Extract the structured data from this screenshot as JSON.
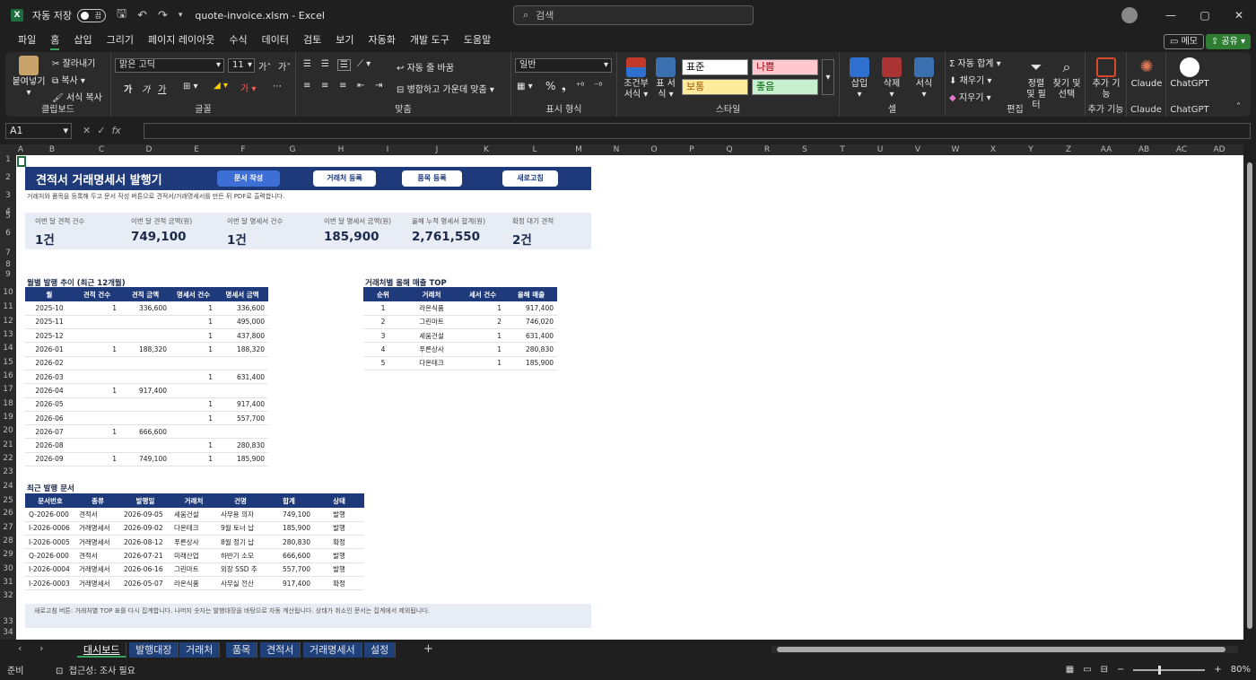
{
  "window": {
    "autosave_label": "자동 저장",
    "autosave_state": "끔",
    "filename": "quote-invoice.xlsm",
    "app": "Excel",
    "search_placeholder": "검색"
  },
  "menu": [
    "파일",
    "홈",
    "삽입",
    "그리기",
    "페이지 레이아웃",
    "수식",
    "데이터",
    "검토",
    "보기",
    "자동화",
    "개발 도구",
    "도움말"
  ],
  "menu_active": "홈",
  "memo_label": "메모",
  "share_label": "공유",
  "ribbon": {
    "paste": "붙여넣기",
    "cut": "잘라내기",
    "copy": "복사",
    "format_painter": "서식 복사",
    "clipboard": "클립보드",
    "font_name": "맑은 고딕",
    "font_size": "11",
    "font_group": "글꼴",
    "wrap_text": "자동 줄 바꿈",
    "merge_center": "병합하고 가운데 맞춤",
    "align_group": "맞춤",
    "number_format": "일반",
    "number_group": "표시 형식",
    "cond_format": "조건부 서식",
    "table_format": "표 서식",
    "style_normal": "표준",
    "style_bad": "나쁨",
    "style_neutral": "보통",
    "style_good": "좋음",
    "style_group": "스타일",
    "insert": "삽입",
    "delete": "삭제",
    "format": "서식",
    "cells_group": "셀",
    "autosum": "자동 합계",
    "fill": "채우기",
    "clear": "지우기",
    "sort_filter": "정렬 및 필터",
    "find_select": "찾기 및 선택",
    "edit_group": "편집",
    "addins": "추가 기능",
    "addins_group": "추가 기능",
    "claude": "Claude",
    "chatgpt": "ChatGPT",
    "fontbtn_b": "가",
    "fontbtn_i": "가",
    "fontbtn_u": "가"
  },
  "formula": {
    "name_box": "A1",
    "fx": "fx",
    "value": ""
  },
  "columns": [
    "A",
    "B",
    "C",
    "D",
    "E",
    "F",
    "G",
    "H",
    "I",
    "J",
    "K",
    "L",
    "M",
    "N",
    "O",
    "P",
    "Q",
    "R",
    "S",
    "T",
    "U",
    "V",
    "W",
    "X",
    "Y",
    "Z",
    "AA",
    "AB",
    "AC",
    "AD"
  ],
  "rows": [
    "1",
    "2",
    "3",
    "4",
    "5",
    "6",
    "7",
    "8",
    "9",
    "10",
    "11",
    "12",
    "13",
    "14",
    "15",
    "16",
    "17",
    "18",
    "19",
    "20",
    "21",
    "22",
    "23",
    "24",
    "25",
    "26",
    "27",
    "28",
    "29",
    "30",
    "31",
    "32",
    "33",
    "34"
  ],
  "dashboard": {
    "title": "견적서 거래명세서 발행기",
    "buttons": [
      "문서 작성",
      "거래처 등록",
      "품목 등록",
      "새로고침"
    ],
    "subtitle": "거래처와 품목을 등록해 두고 문서 작성 버튼으로 견적서/거래명세서를 만든 뒤 PDF로 출력합니다.",
    "kpis": [
      {
        "label": "이번 달 견적 건수",
        "value": "1건"
      },
      {
        "label": "이번 달 견적 금액(원)",
        "value": "749,100"
      },
      {
        "label": "이번 달 명세서 건수",
        "value": "1건"
      },
      {
        "label": "이번 달 명세서 금액(원)",
        "value": "185,900"
      },
      {
        "label": "올해 누적 명세서 합계(원)",
        "value": "2,761,550"
      },
      {
        "label": "확정 대기 견적",
        "value": "2건"
      }
    ],
    "monthly_title": "월별 발행 추이 (최근 12개월)",
    "monthly_headers": [
      "월",
      "견적 건수",
      "견적 금액",
      "명세서 건수",
      "명세서 금액"
    ],
    "monthly_rows": [
      [
        "2025-10",
        "1",
        "336,600",
        "1",
        "336,600"
      ],
      [
        "2025-11",
        "",
        "",
        "1",
        "495,000"
      ],
      [
        "2025-12",
        "",
        "",
        "1",
        "437,800"
      ],
      [
        "2026-01",
        "1",
        "188,320",
        "1",
        "188,320"
      ],
      [
        "2026-02",
        "",
        "",
        "",
        ""
      ],
      [
        "2026-03",
        "",
        "",
        "1",
        "631,400"
      ],
      [
        "2026-04",
        "1",
        "917,400",
        "",
        ""
      ],
      [
        "2026-05",
        "",
        "",
        "1",
        "917,400"
      ],
      [
        "2026-06",
        "",
        "",
        "1",
        "557,700"
      ],
      [
        "2026-07",
        "1",
        "666,600",
        "",
        ""
      ],
      [
        "2026-08",
        "",
        "",
        "1",
        "280,830"
      ],
      [
        "2026-09",
        "1",
        "749,100",
        "1",
        "185,900"
      ]
    ],
    "top_title": "거래처별 올해 매출 TOP",
    "top_headers": [
      "순위",
      "거래처",
      "세서 건수",
      "올해 매출"
    ],
    "top_rows": [
      [
        "1",
        "라온식품",
        "1",
        "917,400"
      ],
      [
        "2",
        "그린마트",
        "2",
        "746,020"
      ],
      [
        "3",
        "세움건설",
        "1",
        "631,400"
      ],
      [
        "4",
        "푸른상사",
        "1",
        "280,830"
      ],
      [
        "5",
        "다온테크",
        "1",
        "185,900"
      ]
    ],
    "recent_title": "최근 발행 문서",
    "recent_headers": [
      "문서번호",
      "종류",
      "발행일",
      "거래처",
      "건명",
      "합계",
      "상태"
    ],
    "recent_rows": [
      [
        "Q-2026-000",
        "견적서",
        "2026-09-05",
        "세움건설",
        "사무용 의자",
        "749,100",
        "발행"
      ],
      [
        "I-2026-0006",
        "거래명세서",
        "2026-09-02",
        "다온테크",
        "9월 토너 납",
        "185,900",
        "발행"
      ],
      [
        "I-2026-0005",
        "거래명세서",
        "2026-08-12",
        "푸른상사",
        "8월 정기 납",
        "280,830",
        "확정"
      ],
      [
        "Q-2026-000",
        "견적서",
        "2026-07-21",
        "미래산업",
        "하반기 소모",
        "666,600",
        "발행"
      ],
      [
        "I-2026-0004",
        "거래명세서",
        "2026-06-16",
        "그린마트",
        "외장 SSD 추",
        "557,700",
        "발행"
      ],
      [
        "I-2026-0003",
        "거래명세서",
        "2026-05-07",
        "라온식품",
        "사무실 전산",
        "917,400",
        "확정"
      ]
    ],
    "footnote": "새로고침 버튼: 거래처별 TOP 표를 다시 집계합니다. 나머지 숫자는 발행대장을 바탕으로 자동 계산됩니다. 상태가 취소인 문서는 집계에서 제외됩니다."
  },
  "sheet_tabs": [
    "대시보드",
    "발행대장",
    "거래처",
    "품목",
    "견적서",
    "거래명세서",
    "설정"
  ],
  "active_tab": "대시보드",
  "status": {
    "ready": "준비",
    "accessibility": "접근성: 조사 필요",
    "zoom": "80%"
  },
  "colors": {
    "banner": "#1f3a7a",
    "accent": "#3aa15a",
    "kpi_bg": "#e8ecf4"
  }
}
